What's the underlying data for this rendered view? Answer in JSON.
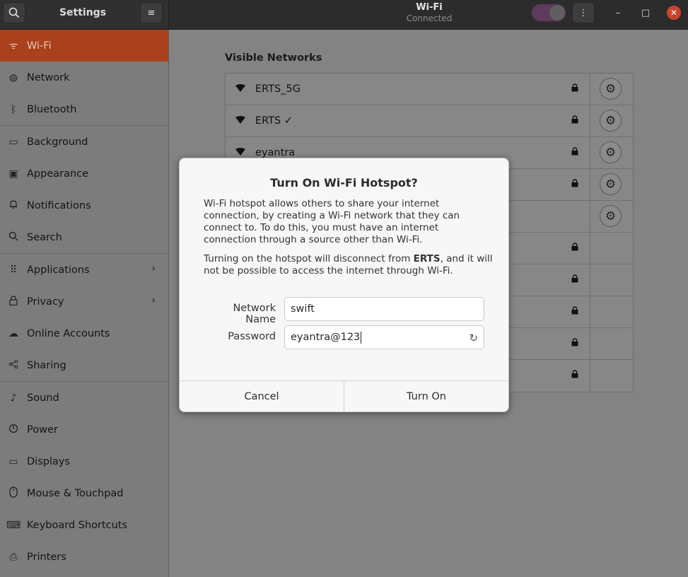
{
  "header": {
    "sidebar_title": "Settings",
    "panel_title": "Wi-Fi",
    "panel_subtitle": "Connected",
    "menu_glyph": "≡",
    "more_glyph": "⋮",
    "minimize_glyph": "–",
    "maximize_glyph": "□",
    "close_glyph": "✕",
    "icons": {
      "search": "search-icon",
      "hamburger": "hamburger-icon"
    }
  },
  "sidebar": {
    "items": [
      {
        "label": "Wi-Fi",
        "icon": "wifi-icon",
        "glyph": "ᯤ",
        "active": true
      },
      {
        "label": "Network",
        "icon": "network-globe-icon",
        "glyph": "◍"
      },
      {
        "label": "Bluetooth",
        "icon": "bluetooth-icon",
        "glyph": "ᛒ"
      },
      {
        "label": "Background",
        "icon": "monitor-icon",
        "glyph": "▭"
      },
      {
        "label": "Appearance",
        "icon": "appearance-icon",
        "glyph": "▣"
      },
      {
        "label": "Notifications",
        "icon": "bell-icon",
        "glyph": "♫"
      },
      {
        "label": "Search",
        "icon": "search-icon",
        "glyph": "⌕"
      },
      {
        "label": "Applications",
        "icon": "grid-icon",
        "glyph": "⠿",
        "chevron": "›"
      },
      {
        "label": "Privacy",
        "icon": "lock-icon",
        "glyph": "🔒",
        "chevron": "›"
      },
      {
        "label": "Online Accounts",
        "icon": "cloud-icon",
        "glyph": "☁"
      },
      {
        "label": "Sharing",
        "icon": "share-icon",
        "glyph": "⋖"
      },
      {
        "label": "Sound",
        "icon": "music-note-icon",
        "glyph": "♪"
      },
      {
        "label": "Power",
        "icon": "power-icon",
        "glyph": "⏻"
      },
      {
        "label": "Displays",
        "icon": "display-icon",
        "glyph": "▭"
      },
      {
        "label": "Mouse & Touchpad",
        "icon": "mouse-icon",
        "glyph": "◯"
      },
      {
        "label": "Keyboard Shortcuts",
        "icon": "keyboard-icon",
        "glyph": "⌨"
      },
      {
        "label": "Printers",
        "icon": "printer-icon",
        "glyph": "⎙"
      }
    ]
  },
  "main": {
    "visible_networks_title": "Visible Networks",
    "networks": [
      {
        "name": "ERTS_5G",
        "secured": true,
        "settings": true
      },
      {
        "name": "ERTS ✓",
        "secured": true,
        "settings": true
      },
      {
        "name": "eyantra",
        "secured": true,
        "settings": true
      },
      {
        "name": "",
        "secured": true,
        "settings": true
      },
      {
        "name": "",
        "secured": false,
        "settings": true
      },
      {
        "name": "",
        "secured": true,
        "settings": false
      },
      {
        "name": "",
        "secured": true,
        "settings": false
      },
      {
        "name": "",
        "secured": true,
        "settings": false
      },
      {
        "name": "",
        "secured": true,
        "settings": false
      },
      {
        "name": "",
        "secured": true,
        "settings": false
      }
    ]
  },
  "dialog": {
    "title": "Turn On Wi-Fi Hotspot?",
    "paragraph1": "Wi-Fi hotspot allows others to share your internet connection, by creating a Wi-Fi network that they can connect to. To do this, you must have an internet connection through a source other than Wi-Fi.",
    "paragraph2_prefix": "Turning on the hotspot will disconnect from ",
    "paragraph2_network": "ERTS",
    "paragraph2_suffix": ", and it will not be possible to access the internet through Wi-Fi.",
    "network_name_label": "Network Name",
    "network_name_value": "swift",
    "password_label": "Password",
    "password_value": "eyantra@123",
    "cancel_label": "Cancel",
    "turn_on_label": "Turn On"
  }
}
